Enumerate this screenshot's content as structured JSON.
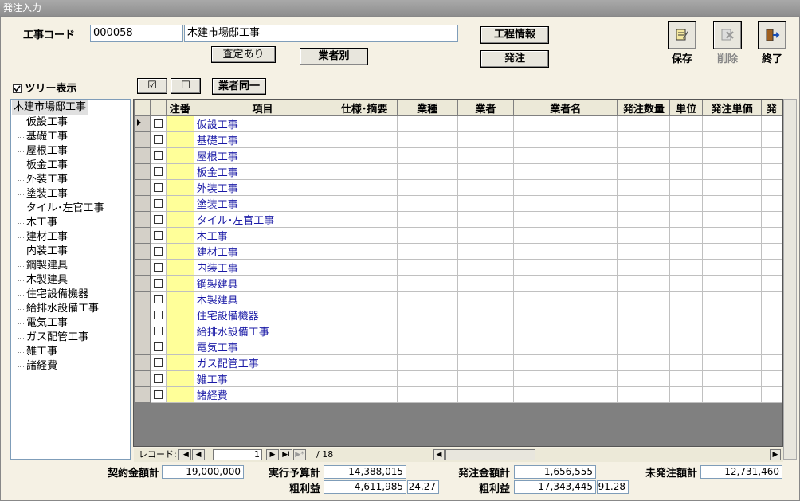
{
  "window": {
    "title": "発注入力"
  },
  "header": {
    "koji_code_label": "工事コード",
    "koji_code_value": "000058",
    "koji_name_value": "木建市場邸工事",
    "status_button": "査定あり",
    "vendor_button": "業者別",
    "process_info_button": "工程情報",
    "order_button": "発注"
  },
  "toolbar": {
    "save_label": "保存",
    "delete_label": "削除",
    "exit_label": "終了",
    "save_icon": "save-icon",
    "delete_icon": "delete-icon",
    "exit_icon": "exit-door-icon"
  },
  "tree_controls": {
    "tree_toggle_label": "ツリー表示",
    "check_all_glyph": "☑",
    "uncheck_all_glyph": "☐",
    "same_vendor_button": "業者同一"
  },
  "tree": {
    "root": "木建市場邸工事",
    "items": [
      "仮設工事",
      "基礎工事",
      "屋根工事",
      "板金工事",
      "外装工事",
      "塗装工事",
      "タイル･左官工事",
      "木工事",
      "建材工事",
      "内装工事",
      "鋼製建具",
      "木製建具",
      "住宅設備機器",
      "給排水設備工事",
      "電気工事",
      "ガス配管工事",
      "雑工事",
      "諸経費"
    ]
  },
  "grid": {
    "columns": [
      "",
      "",
      "注番",
      "項目",
      "仕様･摘要",
      "業種",
      "業者",
      "業者名",
      "発注数量",
      "単位",
      "発注単価",
      "発"
    ],
    "rows": [
      "仮設工事",
      "基礎工事",
      "屋根工事",
      "板金工事",
      "外装工事",
      "塗装工事",
      "タイル･左官工事",
      "木工事",
      "建材工事",
      "内装工事",
      "鋼製建具",
      "木製建具",
      "住宅設備機器",
      "給排水設備工事",
      "電気工事",
      "ガス配管工事",
      "雑工事",
      "諸経費"
    ]
  },
  "navigation": {
    "record_label": "レコード:",
    "current": "1",
    "total": "/ 18",
    "first_glyph": "I◀",
    "prev_glyph": "◀",
    "next_glyph": "▶",
    "last_glyph": "▶I",
    "new_glyph": "▶*"
  },
  "totals": {
    "contract_label": "契約金額計",
    "contract_value": "19,000,000",
    "budget_label": "実行予算計",
    "budget_value": "14,388,015",
    "gross_label_1": "粗利益",
    "gross_value_1": "4,611,985",
    "gross_pct_1": "24.27",
    "ordered_label": "発注金額計",
    "ordered_value": "1,656,555",
    "gross_label_2": "粗利益",
    "gross_value_2": "17,343,445",
    "gross_pct_2": "91.28",
    "unordered_label": "未発注額計",
    "unordered_value": "12,731,460"
  }
}
